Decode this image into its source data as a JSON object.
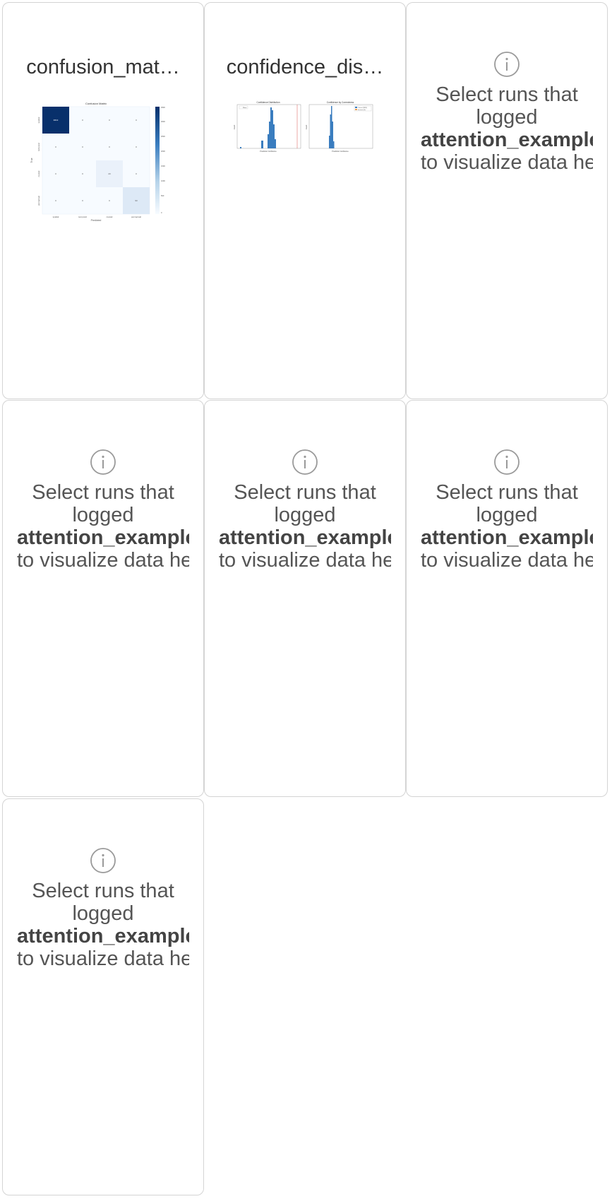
{
  "panels": [
    {
      "title": "confusion_mat…",
      "chart": {
        "title": "Confusion Matrix",
        "xlabel": "Predicted",
        "ylabel": "True",
        "classes": [
          "spatial",
          "temporal",
          "causal",
          "perceptual"
        ],
        "cells": [
          [
            "3613",
            "0",
            "0",
            "0"
          ],
          [
            "0",
            "0",
            "0",
            "0"
          ],
          [
            "0",
            "0",
            "23",
            "0"
          ],
          [
            "0",
            "0",
            "0",
            "93"
          ]
        ],
        "colorbar_ticks": [
          "3500",
          "3000",
          "2500",
          "2000",
          "1500",
          "1000",
          "500",
          "0"
        ]
      }
    },
    {
      "title": "confidence_dis…",
      "chart": {
        "left_title": "Confidence Distribution",
        "left_legend": "Mean",
        "left_xlabel": "Prediction Confidence",
        "left_ylabel": "Count",
        "right_title": "Confidence by Correctness",
        "right_legend": [
          "Correct (3616)",
          "Incorrect (0)"
        ],
        "right_xlabel": "Prediction Confidence",
        "right_ylabel": "Count"
      }
    }
  ],
  "empty_state": {
    "line1": "Select runs that",
    "line2": "logged",
    "key": "attention_examples",
    "line3": "to visualize data here"
  },
  "colors": {
    "heatmap_dark": "#08306b",
    "heatmap_light": "#f7fbff",
    "histogram": "#3a7dbf",
    "mean_line": "#d9534f",
    "panel_border": "#d4d4d4"
  }
}
